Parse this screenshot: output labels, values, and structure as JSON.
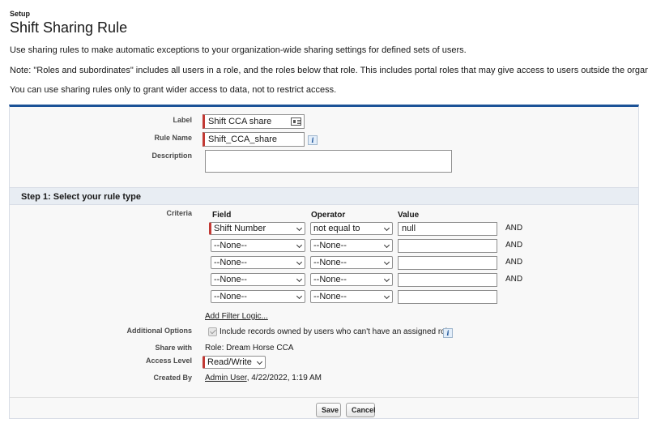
{
  "header": {
    "setup": "Setup",
    "title": "Shift Sharing Rule"
  },
  "intro": {
    "line1": "Use sharing rules to make automatic exceptions to your organization-wide sharing settings for defined sets of users.",
    "line2": "Note: \"Roles and subordinates\" includes all users in a role, and the roles below that role. This includes portal roles that may give access to users outside the organization.",
    "line3": "You can use sharing rules only to grant wider access to data, not to restrict access."
  },
  "form": {
    "label_label": "Label",
    "label_value": "Shift CCA share",
    "rule_name_label": "Rule Name",
    "rule_name_value": "Shift_CCA_share",
    "description_label": "Description",
    "description_value": ""
  },
  "step1": {
    "title": "Step 1: Select your rule type",
    "criteria_label": "Criteria",
    "headers": {
      "field": "Field",
      "operator": "Operator",
      "value": "Value"
    },
    "rows": [
      {
        "field": "Shift Number",
        "operator": "not equal to",
        "value": "null",
        "conj": "AND"
      },
      {
        "field": "--None--",
        "operator": "--None--",
        "value": "",
        "conj": "AND"
      },
      {
        "field": "--None--",
        "operator": "--None--",
        "value": "",
        "conj": "AND"
      },
      {
        "field": "--None--",
        "operator": "--None--",
        "value": "",
        "conj": "AND"
      },
      {
        "field": "--None--",
        "operator": "--None--",
        "value": "",
        "conj": ""
      }
    ],
    "filter_logic_link": "Add Filter Logic...",
    "additional_options_label": "Additional Options",
    "additional_options_text": "Include records owned by users who can't have an assigned role",
    "additional_options_checked": true,
    "share_with_label": "Share with",
    "share_with_value": "Role: Dream Horse CCA",
    "access_level_label": "Access Level",
    "access_level_value": "Read/Write",
    "created_by_label": "Created By",
    "created_by_user": "Admin User",
    "created_by_date": ", 4/22/2022, 1:19 AM"
  },
  "buttons": {
    "save": "Save",
    "cancel": "Cancel"
  },
  "colors": {
    "panel_top_border": "#1b5297",
    "required_bar": "#c23934",
    "section_bar": "#e8edf3"
  },
  "icons": {
    "contact_card": "contact-card-icon",
    "info": "info-icon",
    "dropdown": "chevron-down-icon"
  }
}
